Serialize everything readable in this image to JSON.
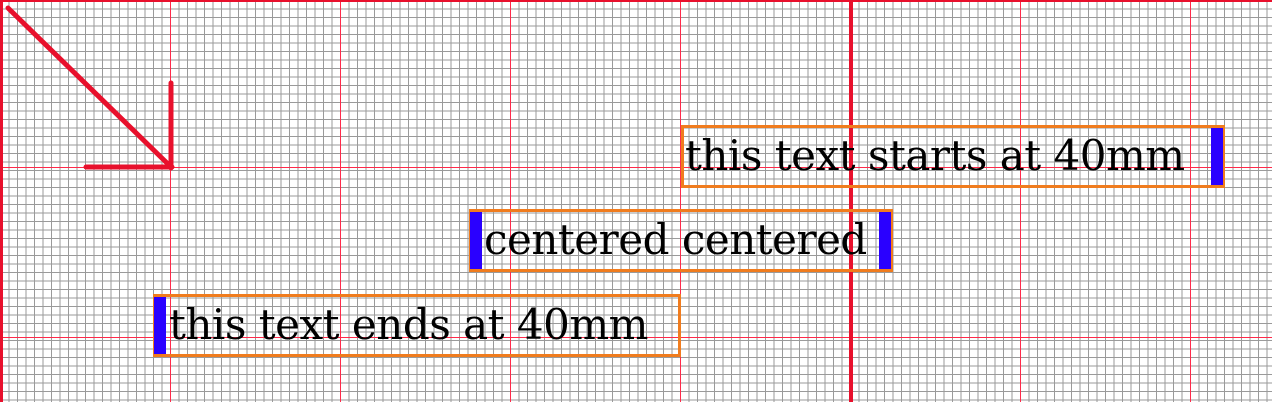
{
  "colors": {
    "grid_minor": "#9a9a9a",
    "grid_major": "#ff2a4a",
    "origin_line": "#e8102c",
    "arrow": "#e8102c",
    "box_border": "#f07c1e",
    "cursor": "#2a00ff",
    "text": "#000000"
  },
  "texts": {
    "start": "this text starts at 40mm",
    "centered": "centered centered",
    "end": "this text ends at 40mm"
  },
  "icons": {
    "arrow": "arrow-down-right-icon"
  }
}
